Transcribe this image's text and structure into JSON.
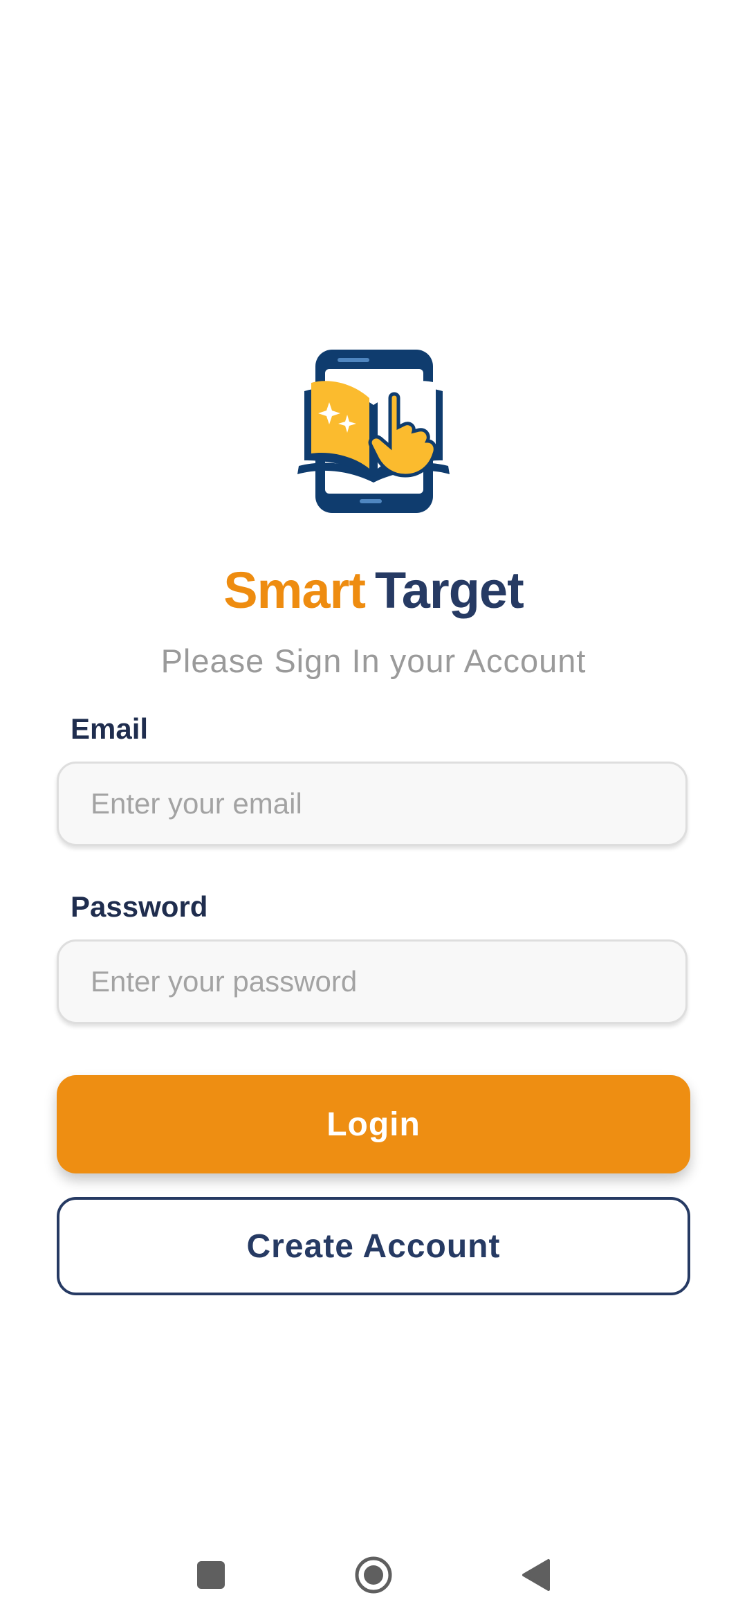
{
  "brand": {
    "name_part1": "Smart",
    "name_part2": "Target",
    "logo_icon": "book-phone-tap-icon",
    "colors": {
      "orange": "#ee8c10",
      "navy": "#263a63"
    }
  },
  "subtitle": "Please Sign In your Account",
  "form": {
    "email": {
      "label": "Email",
      "placeholder": "Enter your email",
      "value": ""
    },
    "password": {
      "label": "Password",
      "placeholder": "Enter your password",
      "value": ""
    }
  },
  "buttons": {
    "login": "Login",
    "create_account": "Create Account"
  },
  "navbar": {
    "icons": [
      "recents-square-icon",
      "home-circle-icon",
      "back-triangle-icon"
    ]
  }
}
